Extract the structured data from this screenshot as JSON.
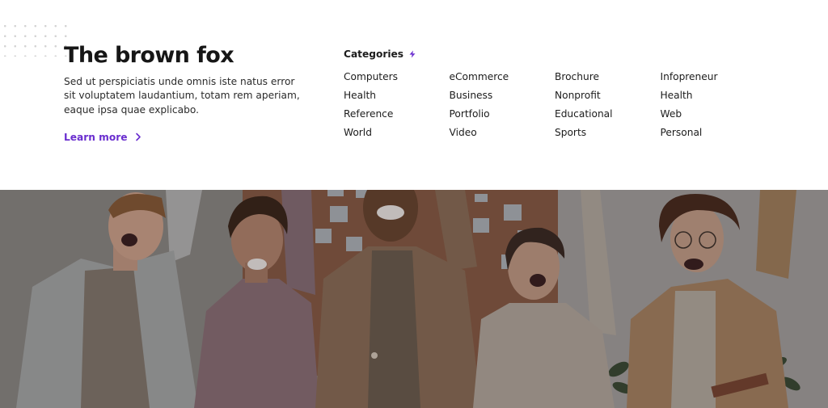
{
  "hero": {
    "title": "The brown fox",
    "description": "Sed ut perspiciatis unde omnis iste natus error sit voluptatem laudantium, totam rem aperiam, eaque ipsa quae explicabo.",
    "learn_more": "Learn more",
    "accent_color": "#6a2ecf"
  },
  "categories": {
    "title": "Categories",
    "columns": [
      [
        "Computers",
        "Health",
        "Reference",
        "World"
      ],
      [
        "eCommerce",
        "Business",
        "Portfolio",
        "Video"
      ],
      [
        "Brochure",
        "Nonprofit",
        "Educational",
        "Sports"
      ],
      [
        "Infopreneur",
        "Health",
        "Web",
        "Personal"
      ]
    ]
  },
  "photo": {
    "subject": "Five smiling people raising their arms in celebration in an office"
  }
}
